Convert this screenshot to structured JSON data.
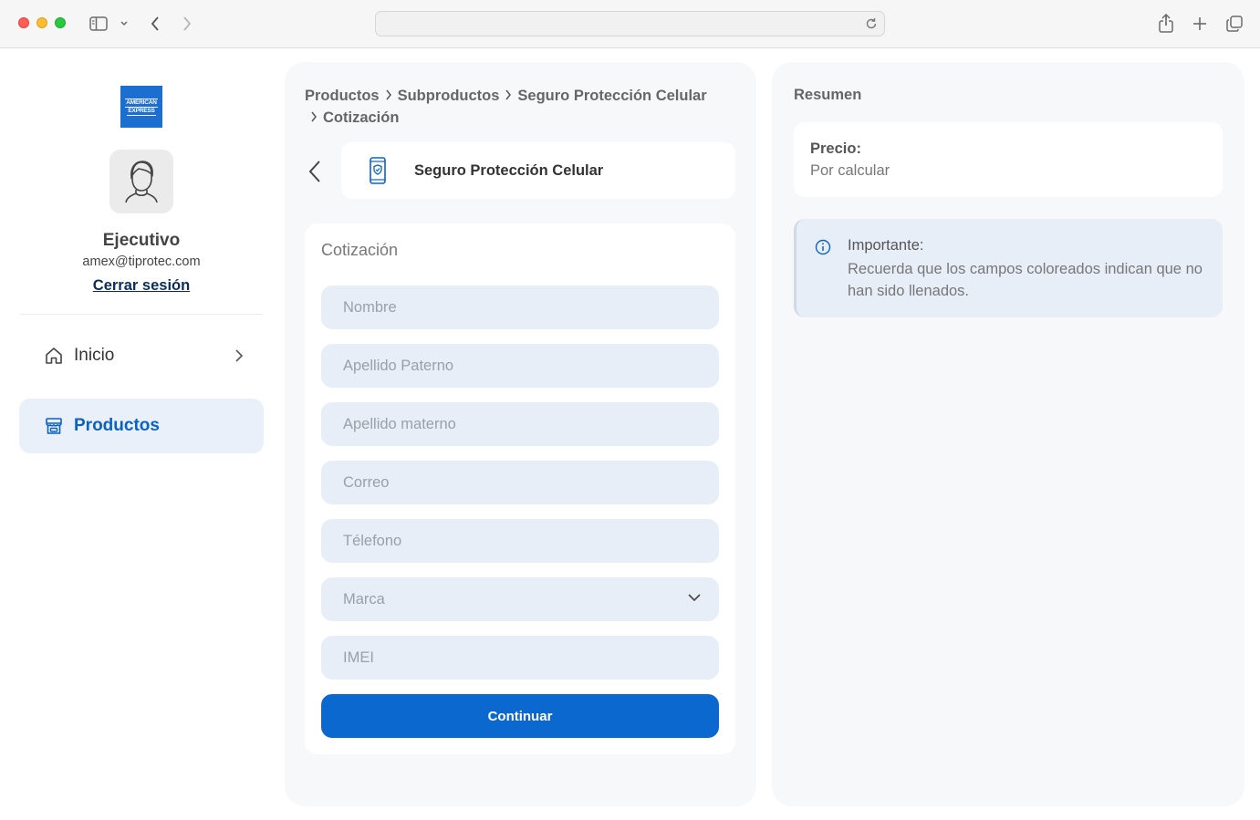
{
  "sidebar": {
    "logo_line1": "AMERICAN",
    "logo_line2": "EXPRESS",
    "user_name": "Ejecutivo",
    "user_email": "amex@tiprotec.com",
    "logout_label": "Cerrar sesión",
    "nav": [
      {
        "label": "Inicio",
        "icon": "home-icon",
        "active": false
      },
      {
        "label": "Productos",
        "icon": "store-icon",
        "active": true
      }
    ]
  },
  "breadcrumb": {
    "items": [
      "Productos",
      "Subproductos",
      "Seguro Protección Celular",
      "Cotización"
    ]
  },
  "product": {
    "name": "Seguro Protección Celular",
    "icon": "phone-shield-icon"
  },
  "form": {
    "title": "Cotización",
    "fields": {
      "nombre": "Nombre",
      "apellido_paterno": "Apellido Paterno",
      "apellido_materno": "Apellido materno",
      "correo": "Correo",
      "telefono": "Télefono",
      "marca": "Marca",
      "imei": "IMEI"
    },
    "submit_label": "Continuar"
  },
  "summary": {
    "title": "Resumen",
    "price_label": "Precio:",
    "price_value": "Por calcular",
    "notice_title": "Importante:",
    "notice_text": "Recuerda que los campos coloreados indican que no han sido llenados."
  },
  "colors": {
    "primary": "#0a68cf",
    "field_bg": "#e8eef8",
    "panel_bg": "#f7f8fa",
    "nav_active_bg": "#e9f0fa"
  }
}
